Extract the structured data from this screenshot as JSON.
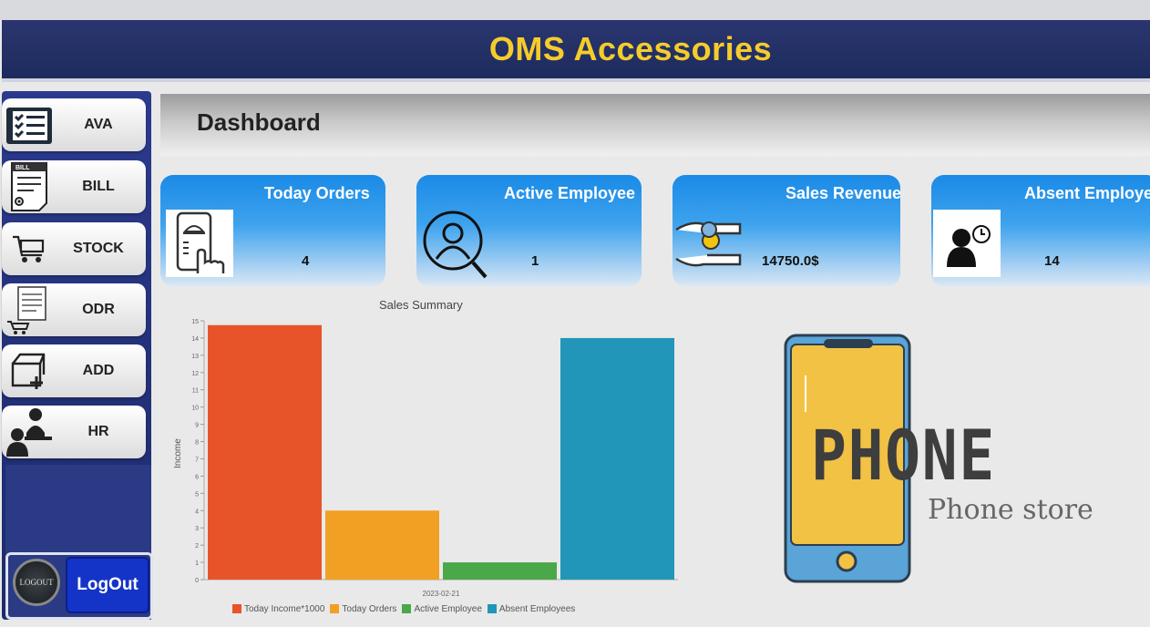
{
  "app": {
    "title": "OMS Accessories"
  },
  "sidebar": {
    "items": [
      {
        "label": "AVA",
        "icon": "checklist-icon"
      },
      {
        "label": "BILL",
        "icon": "bill-icon"
      },
      {
        "label": "STOCK",
        "icon": "cart-icon"
      },
      {
        "label": "ODR",
        "icon": "order-list-icon"
      },
      {
        "label": "ADD",
        "icon": "add-box-icon"
      },
      {
        "label": "HR",
        "icon": "hr-people-icon"
      }
    ],
    "bill_icon_text": "BILL",
    "logout_round_label": "LOGOUT",
    "logout_button_label": "LogOut"
  },
  "dashboard": {
    "title": "Dashboard"
  },
  "cards": [
    {
      "title": "Today Orders",
      "value": "4",
      "icon": "mobile-order-icon"
    },
    {
      "title": "Active Employee",
      "value": "1",
      "icon": "employee-search-icon"
    },
    {
      "title": "Sales Revenue",
      "value": "14750.0$",
      "icon": "money-hands-icon"
    },
    {
      "title": "Absent Employe",
      "value": "14",
      "icon": "absent-clock-icon"
    }
  ],
  "chart_data": {
    "type": "bar",
    "title": "Sales Summary",
    "ylabel": "Income",
    "categories": [
      "2023-02-21"
    ],
    "ylim": [
      0,
      15
    ],
    "yticks": [
      0,
      1,
      2,
      3,
      4,
      5,
      6,
      7,
      8,
      9,
      10,
      11,
      12,
      13,
      14,
      15
    ],
    "series": [
      {
        "name": "Today Income*1000",
        "values": [
          14.75
        ],
        "color": "#e8542a"
      },
      {
        "name": "Today Orders",
        "values": [
          4
        ],
        "color": "#f2a024"
      },
      {
        "name": "Active Employee",
        "values": [
          1
        ],
        "color": "#4aa84a"
      },
      {
        "name": "Absent Employees",
        "values": [
          14
        ],
        "color": "#2196b8"
      }
    ],
    "legend": "bottom",
    "grid": false
  },
  "brand": {
    "word": "PHONE",
    "subtitle": "Phone store",
    "colors": {
      "phone_body": "#f2c244",
      "phone_frame": "#5aa4d8"
    }
  }
}
